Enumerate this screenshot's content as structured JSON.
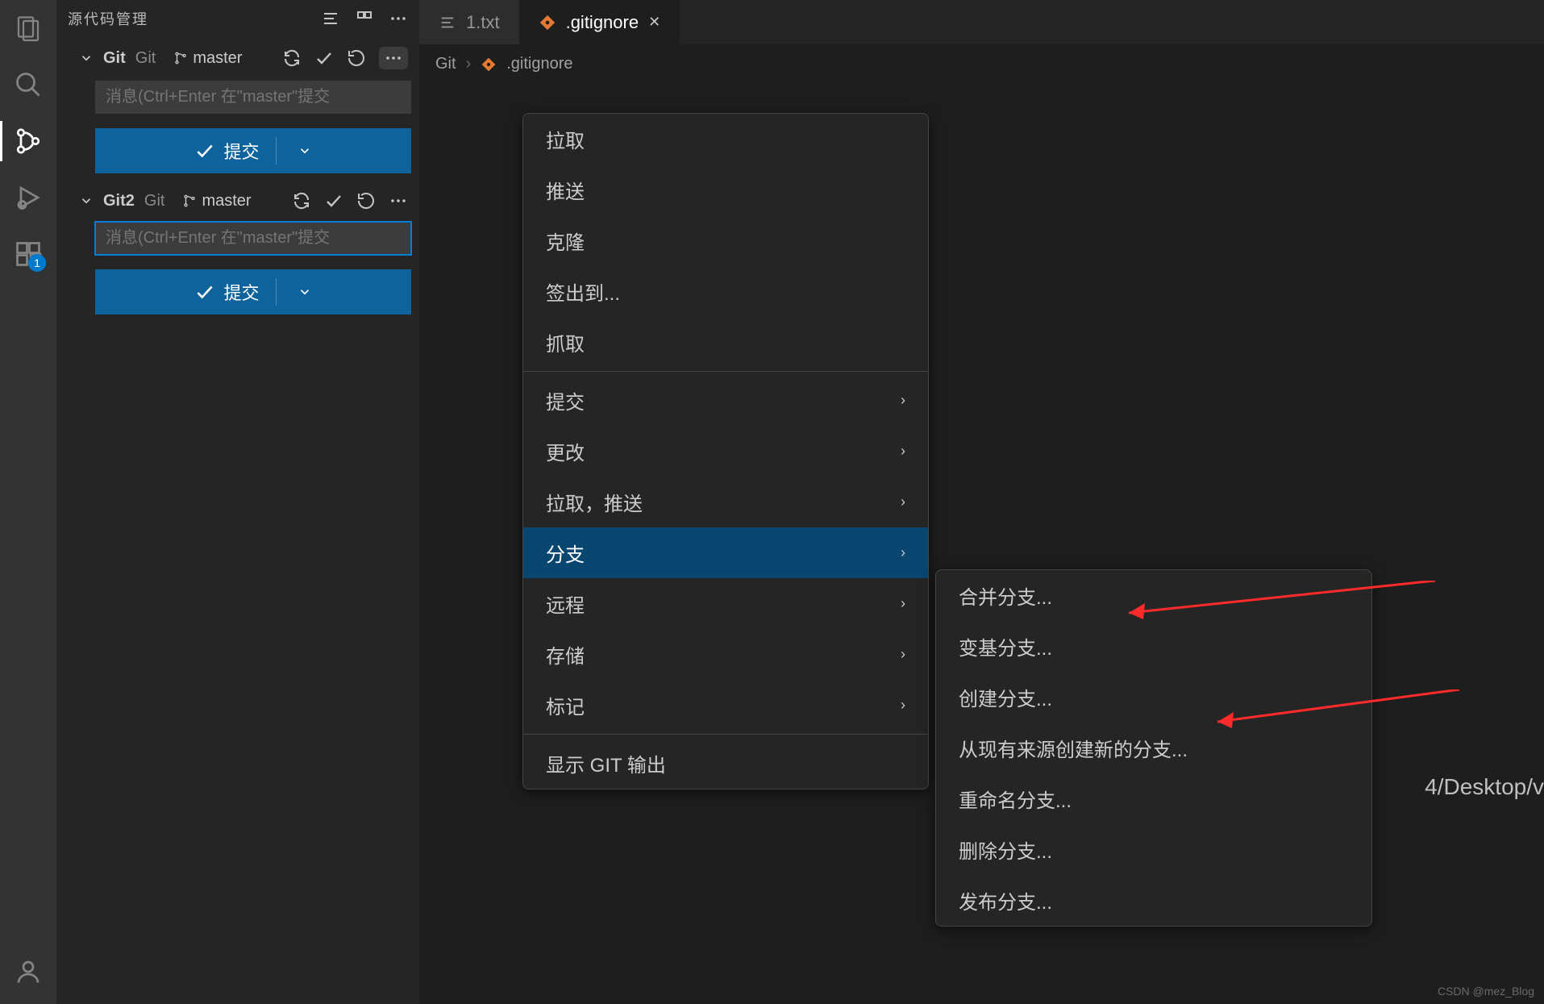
{
  "sidebar": {
    "title": "源代码管理",
    "repos": [
      {
        "name": "Git",
        "sub": "Git",
        "branch": "master",
        "commit_placeholder": "消息(Ctrl+Enter 在\"master\"提交",
        "commit_btn": "提交"
      },
      {
        "name": "Git2",
        "sub": "Git",
        "branch": "master",
        "commit_placeholder": "消息(Ctrl+Enter 在\"master\"提交",
        "commit_btn": "提交"
      }
    ]
  },
  "tabs": [
    {
      "label": "1.txt",
      "icon": "file"
    },
    {
      "label": ".gitignore",
      "icon": "gitignore",
      "active": true
    }
  ],
  "breadcrumb": {
    "root": "Git",
    "file": ".gitignore"
  },
  "editor": {
    "path_fragment": "4/Desktop/v"
  },
  "menu1": [
    {
      "label": "拉取"
    },
    {
      "label": "推送"
    },
    {
      "label": "克隆"
    },
    {
      "label": "签出到..."
    },
    {
      "label": "抓取"
    },
    {
      "sep": true
    },
    {
      "label": "提交",
      "submenu": true
    },
    {
      "label": "更改",
      "submenu": true
    },
    {
      "label": "拉取，推送",
      "submenu": true
    },
    {
      "label": "分支",
      "submenu": true,
      "highlight": true
    },
    {
      "label": "远程",
      "submenu": true
    },
    {
      "label": "存储",
      "submenu": true
    },
    {
      "label": "标记",
      "submenu": true
    },
    {
      "sep": true
    },
    {
      "label": "显示 GIT 输出"
    }
  ],
  "menu2": [
    {
      "label": "合并分支..."
    },
    {
      "label": "变基分支..."
    },
    {
      "label": "创建分支..."
    },
    {
      "label": "从现有来源创建新的分支..."
    },
    {
      "label": "重命名分支..."
    },
    {
      "label": "删除分支..."
    },
    {
      "label": "发布分支..."
    }
  ],
  "extensions_badge": "1",
  "watermark": "CSDN @mez_Blog"
}
